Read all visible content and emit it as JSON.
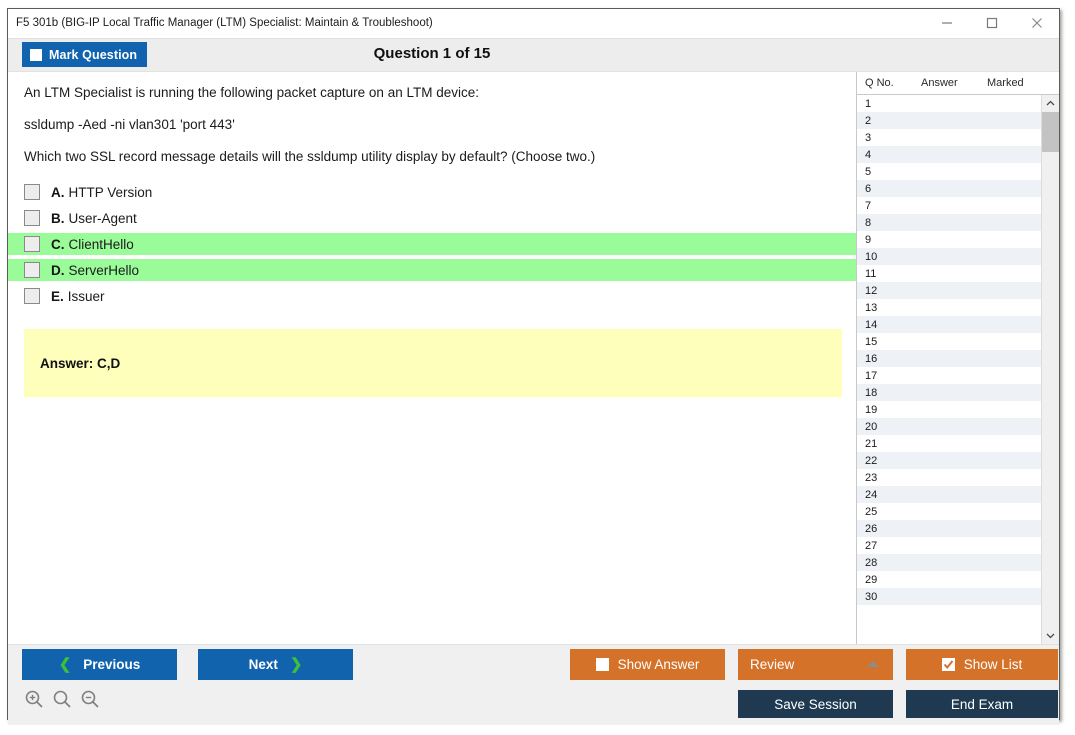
{
  "window": {
    "title": "F5 301b (BIG-IP Local Traffic Manager (LTM) Specialist: Maintain & Troubleshoot)",
    "controls": {
      "minimize": "minimize-icon",
      "maximize": "maximize-icon",
      "close": "close-icon"
    }
  },
  "header": {
    "mark_question_label": "Mark Question",
    "mark_question_checked": false,
    "question_title": "Question 1 of 15"
  },
  "question": {
    "lines": [
      "An LTM Specialist is running the following packet capture on an LTM device:",
      "ssldump -Aed -ni vlan301 'port 443'",
      "Which two SSL record message details will the ssldump utility display by default? (Choose two.)"
    ],
    "options": [
      {
        "letter": "A.",
        "text": "HTTP Version",
        "checked": false,
        "highlighted": false
      },
      {
        "letter": "B.",
        "text": "User-Agent",
        "checked": false,
        "highlighted": false
      },
      {
        "letter": "C.",
        "text": "ClientHello",
        "checked": false,
        "highlighted": true
      },
      {
        "letter": "D.",
        "text": "ServerHello",
        "checked": false,
        "highlighted": true
      },
      {
        "letter": "E.",
        "text": "Issuer",
        "checked": false,
        "highlighted": false
      }
    ],
    "answer_text": "Answer: C,D"
  },
  "list_panel": {
    "columns": [
      "Q No.",
      "Answer",
      "Marked"
    ],
    "rows": [
      {
        "no": "1",
        "answer": "",
        "marked": ""
      },
      {
        "no": "2",
        "answer": "",
        "marked": ""
      },
      {
        "no": "3",
        "answer": "",
        "marked": ""
      },
      {
        "no": "4",
        "answer": "",
        "marked": ""
      },
      {
        "no": "5",
        "answer": "",
        "marked": ""
      },
      {
        "no": "6",
        "answer": "",
        "marked": ""
      },
      {
        "no": "7",
        "answer": "",
        "marked": ""
      },
      {
        "no": "8",
        "answer": "",
        "marked": ""
      },
      {
        "no": "9",
        "answer": "",
        "marked": ""
      },
      {
        "no": "10",
        "answer": "",
        "marked": ""
      },
      {
        "no": "11",
        "answer": "",
        "marked": ""
      },
      {
        "no": "12",
        "answer": "",
        "marked": ""
      },
      {
        "no": "13",
        "answer": "",
        "marked": ""
      },
      {
        "no": "14",
        "answer": "",
        "marked": ""
      },
      {
        "no": "15",
        "answer": "",
        "marked": ""
      },
      {
        "no": "16",
        "answer": "",
        "marked": ""
      },
      {
        "no": "17",
        "answer": "",
        "marked": ""
      },
      {
        "no": "18",
        "answer": "",
        "marked": ""
      },
      {
        "no": "19",
        "answer": "",
        "marked": ""
      },
      {
        "no": "20",
        "answer": "",
        "marked": ""
      },
      {
        "no": "21",
        "answer": "",
        "marked": ""
      },
      {
        "no": "22",
        "answer": "",
        "marked": ""
      },
      {
        "no": "23",
        "answer": "",
        "marked": ""
      },
      {
        "no": "24",
        "answer": "",
        "marked": ""
      },
      {
        "no": "25",
        "answer": "",
        "marked": ""
      },
      {
        "no": "26",
        "answer": "",
        "marked": ""
      },
      {
        "no": "27",
        "answer": "",
        "marked": ""
      },
      {
        "no": "28",
        "answer": "",
        "marked": ""
      },
      {
        "no": "29",
        "answer": "",
        "marked": ""
      },
      {
        "no": "30",
        "answer": "",
        "marked": ""
      }
    ]
  },
  "toolbar": {
    "previous_label": "Previous",
    "next_label": "Next",
    "show_answer_label": "Show Answer",
    "show_answer_checked": false,
    "review_label": "Review",
    "show_list_label": "Show List",
    "show_list_checked": true,
    "save_session_label": "Save Session",
    "end_exam_label": "End Exam",
    "zoom_icons": [
      "zoom-in-icon",
      "zoom-reset-icon",
      "zoom-out-icon"
    ]
  },
  "colors": {
    "primary_blue": "#1263ae",
    "orange": "#d5722a",
    "navy": "#1e3950",
    "highlight_green": "#99fc99",
    "answer_yellow": "#ffffbc",
    "chevron_green": "#3cc13c"
  }
}
